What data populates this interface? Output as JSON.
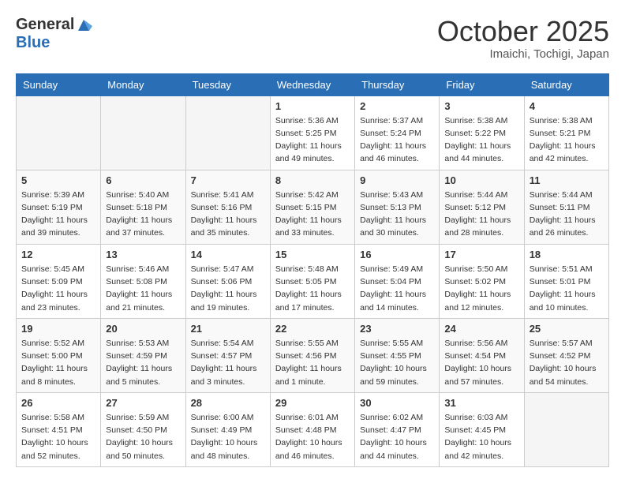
{
  "header": {
    "logo_line1": "General",
    "logo_line2": "Blue",
    "month": "October 2025",
    "location": "Imaichi, Tochigi, Japan"
  },
  "days_of_week": [
    "Sunday",
    "Monday",
    "Tuesday",
    "Wednesday",
    "Thursday",
    "Friday",
    "Saturday"
  ],
  "weeks": [
    [
      {
        "day": "",
        "info": ""
      },
      {
        "day": "",
        "info": ""
      },
      {
        "day": "",
        "info": ""
      },
      {
        "day": "1",
        "info": "Sunrise: 5:36 AM\nSunset: 5:25 PM\nDaylight: 11 hours\nand 49 minutes."
      },
      {
        "day": "2",
        "info": "Sunrise: 5:37 AM\nSunset: 5:24 PM\nDaylight: 11 hours\nand 46 minutes."
      },
      {
        "day": "3",
        "info": "Sunrise: 5:38 AM\nSunset: 5:22 PM\nDaylight: 11 hours\nand 44 minutes."
      },
      {
        "day": "4",
        "info": "Sunrise: 5:38 AM\nSunset: 5:21 PM\nDaylight: 11 hours\nand 42 minutes."
      }
    ],
    [
      {
        "day": "5",
        "info": "Sunrise: 5:39 AM\nSunset: 5:19 PM\nDaylight: 11 hours\nand 39 minutes."
      },
      {
        "day": "6",
        "info": "Sunrise: 5:40 AM\nSunset: 5:18 PM\nDaylight: 11 hours\nand 37 minutes."
      },
      {
        "day": "7",
        "info": "Sunrise: 5:41 AM\nSunset: 5:16 PM\nDaylight: 11 hours\nand 35 minutes."
      },
      {
        "day": "8",
        "info": "Sunrise: 5:42 AM\nSunset: 5:15 PM\nDaylight: 11 hours\nand 33 minutes."
      },
      {
        "day": "9",
        "info": "Sunrise: 5:43 AM\nSunset: 5:13 PM\nDaylight: 11 hours\nand 30 minutes."
      },
      {
        "day": "10",
        "info": "Sunrise: 5:44 AM\nSunset: 5:12 PM\nDaylight: 11 hours\nand 28 minutes."
      },
      {
        "day": "11",
        "info": "Sunrise: 5:44 AM\nSunset: 5:11 PM\nDaylight: 11 hours\nand 26 minutes."
      }
    ],
    [
      {
        "day": "12",
        "info": "Sunrise: 5:45 AM\nSunset: 5:09 PM\nDaylight: 11 hours\nand 23 minutes."
      },
      {
        "day": "13",
        "info": "Sunrise: 5:46 AM\nSunset: 5:08 PM\nDaylight: 11 hours\nand 21 minutes."
      },
      {
        "day": "14",
        "info": "Sunrise: 5:47 AM\nSunset: 5:06 PM\nDaylight: 11 hours\nand 19 minutes."
      },
      {
        "day": "15",
        "info": "Sunrise: 5:48 AM\nSunset: 5:05 PM\nDaylight: 11 hours\nand 17 minutes."
      },
      {
        "day": "16",
        "info": "Sunrise: 5:49 AM\nSunset: 5:04 PM\nDaylight: 11 hours\nand 14 minutes."
      },
      {
        "day": "17",
        "info": "Sunrise: 5:50 AM\nSunset: 5:02 PM\nDaylight: 11 hours\nand 12 minutes."
      },
      {
        "day": "18",
        "info": "Sunrise: 5:51 AM\nSunset: 5:01 PM\nDaylight: 11 hours\nand 10 minutes."
      }
    ],
    [
      {
        "day": "19",
        "info": "Sunrise: 5:52 AM\nSunset: 5:00 PM\nDaylight: 11 hours\nand 8 minutes."
      },
      {
        "day": "20",
        "info": "Sunrise: 5:53 AM\nSunset: 4:59 PM\nDaylight: 11 hours\nand 5 minutes."
      },
      {
        "day": "21",
        "info": "Sunrise: 5:54 AM\nSunset: 4:57 PM\nDaylight: 11 hours\nand 3 minutes."
      },
      {
        "day": "22",
        "info": "Sunrise: 5:55 AM\nSunset: 4:56 PM\nDaylight: 11 hours\nand 1 minute."
      },
      {
        "day": "23",
        "info": "Sunrise: 5:55 AM\nSunset: 4:55 PM\nDaylight: 10 hours\nand 59 minutes."
      },
      {
        "day": "24",
        "info": "Sunrise: 5:56 AM\nSunset: 4:54 PM\nDaylight: 10 hours\nand 57 minutes."
      },
      {
        "day": "25",
        "info": "Sunrise: 5:57 AM\nSunset: 4:52 PM\nDaylight: 10 hours\nand 54 minutes."
      }
    ],
    [
      {
        "day": "26",
        "info": "Sunrise: 5:58 AM\nSunset: 4:51 PM\nDaylight: 10 hours\nand 52 minutes."
      },
      {
        "day": "27",
        "info": "Sunrise: 5:59 AM\nSunset: 4:50 PM\nDaylight: 10 hours\nand 50 minutes."
      },
      {
        "day": "28",
        "info": "Sunrise: 6:00 AM\nSunset: 4:49 PM\nDaylight: 10 hours\nand 48 minutes."
      },
      {
        "day": "29",
        "info": "Sunrise: 6:01 AM\nSunset: 4:48 PM\nDaylight: 10 hours\nand 46 minutes."
      },
      {
        "day": "30",
        "info": "Sunrise: 6:02 AM\nSunset: 4:47 PM\nDaylight: 10 hours\nand 44 minutes."
      },
      {
        "day": "31",
        "info": "Sunrise: 6:03 AM\nSunset: 4:45 PM\nDaylight: 10 hours\nand 42 minutes."
      },
      {
        "day": "",
        "info": ""
      }
    ]
  ]
}
